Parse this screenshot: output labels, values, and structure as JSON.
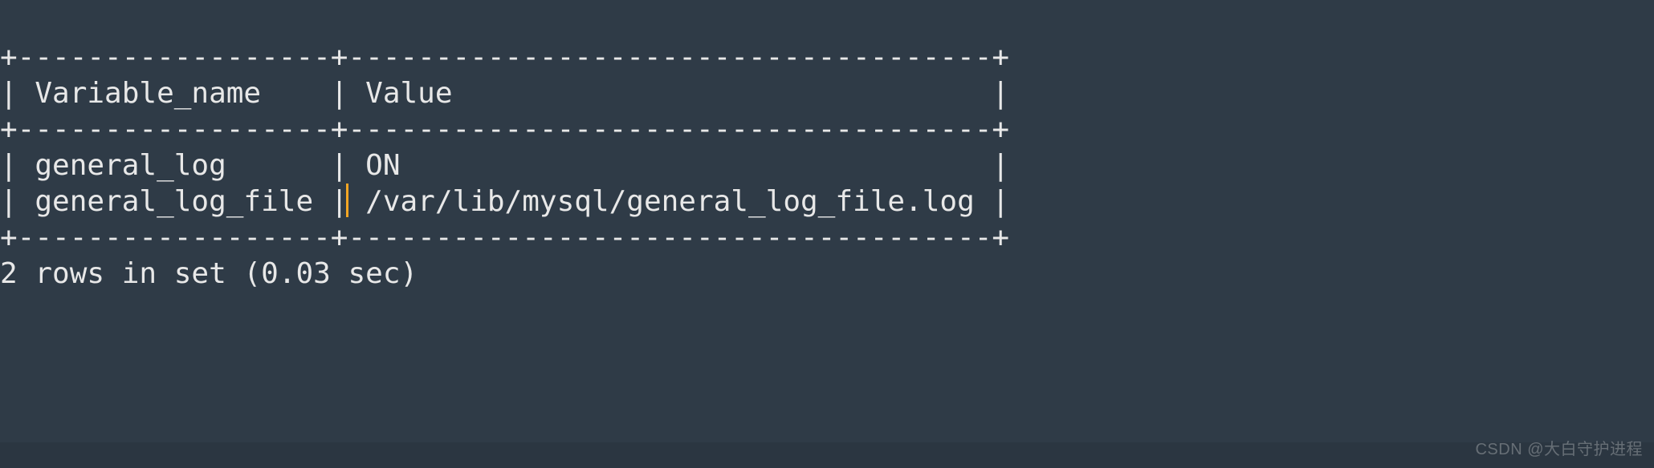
{
  "table": {
    "border_top": "+------------------+-------------------------------------+",
    "header": "| Variable_name    | Value                               |",
    "border_mid": "+------------------+-------------------------------------+",
    "rows": [
      "| general_log      | ON                                  |",
      "| general_log_file | /var/lib/mysql/general_log_file.log |"
    ],
    "border_bot": "+------------------+-------------------------------------+",
    "row_left_2": "| general_log_file |",
    "row_right_2": " /var/lib/mysql/general_log_file.log |"
  },
  "summary": "2 rows in set (0.03 sec)",
  "watermark": "CSDN @大白守护进程",
  "chart_data": {
    "type": "table",
    "title": "",
    "columns": [
      "Variable_name",
      "Value"
    ],
    "rows": [
      [
        "general_log",
        "ON"
      ],
      [
        "general_log_file",
        "/var/lib/mysql/general_log_file.log"
      ]
    ],
    "footer": "2 rows in set (0.03 sec)"
  }
}
